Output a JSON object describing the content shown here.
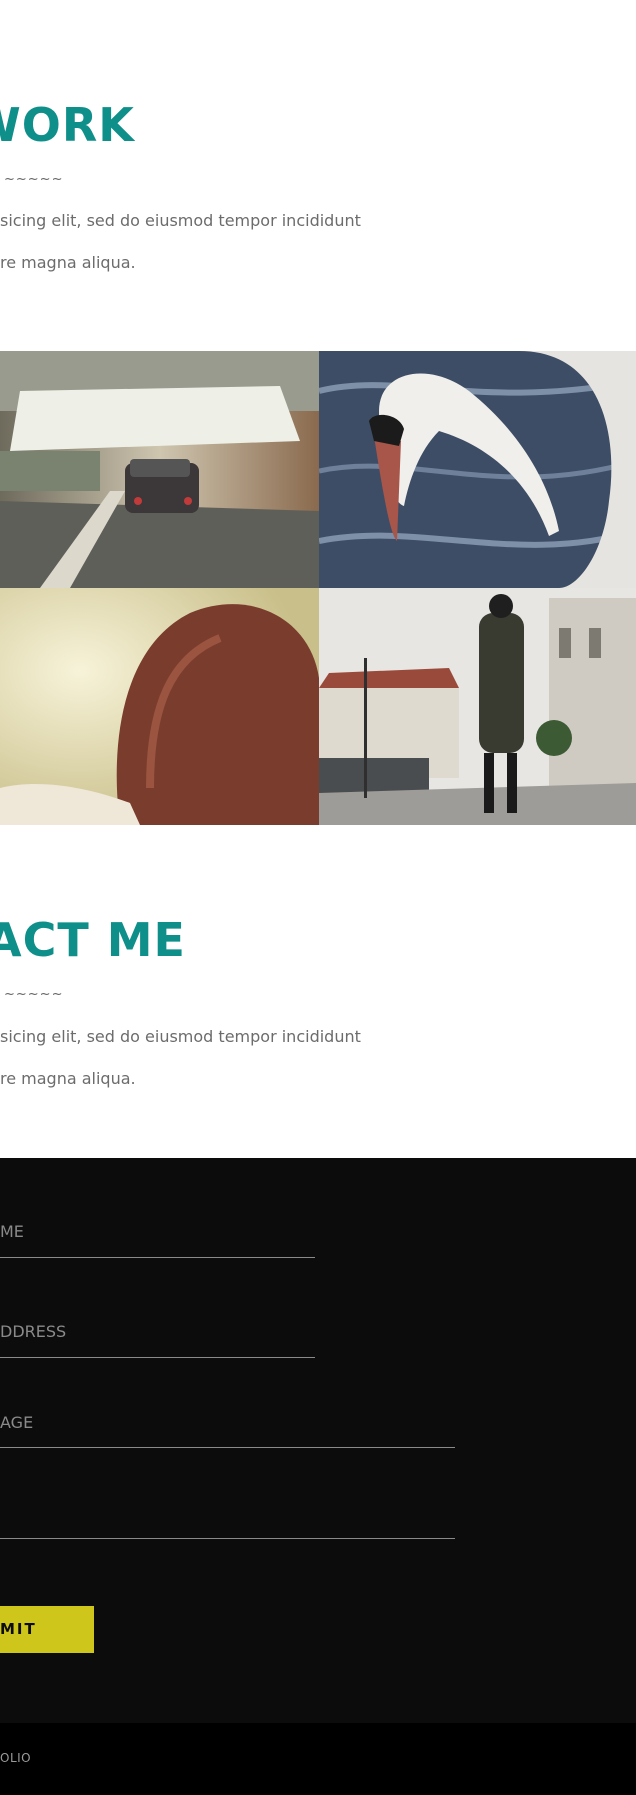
{
  "work": {
    "heading": "WORK",
    "divider": "~~~~~",
    "line1": "sicing elit, sed do eiusmod tempor incididunt",
    "line2": "re magna aliqua."
  },
  "gallery": {
    "items": [
      {
        "name": "car-in-tunnel"
      },
      {
        "name": "swan-on-water"
      },
      {
        "name": "red-haired-woman"
      },
      {
        "name": "woman-walking-street"
      }
    ]
  },
  "contact": {
    "heading": "ACT ME",
    "divider": "~~~~~",
    "line1": "sicing elit, sed do eiusmod tempor incididunt",
    "line2": "re magna aliqua.",
    "form": {
      "name_placeholder": "ME",
      "email_placeholder": "DDRESS",
      "message_placeholder": "AGE",
      "submit_label": "MIT"
    }
  },
  "footer": {
    "text": "OLIO"
  },
  "colors": {
    "heading": "#0f8f8a",
    "dark_bg": "#0c0c0c",
    "footer_bg": "#000000",
    "submit_bg": "#cfc61c"
  }
}
